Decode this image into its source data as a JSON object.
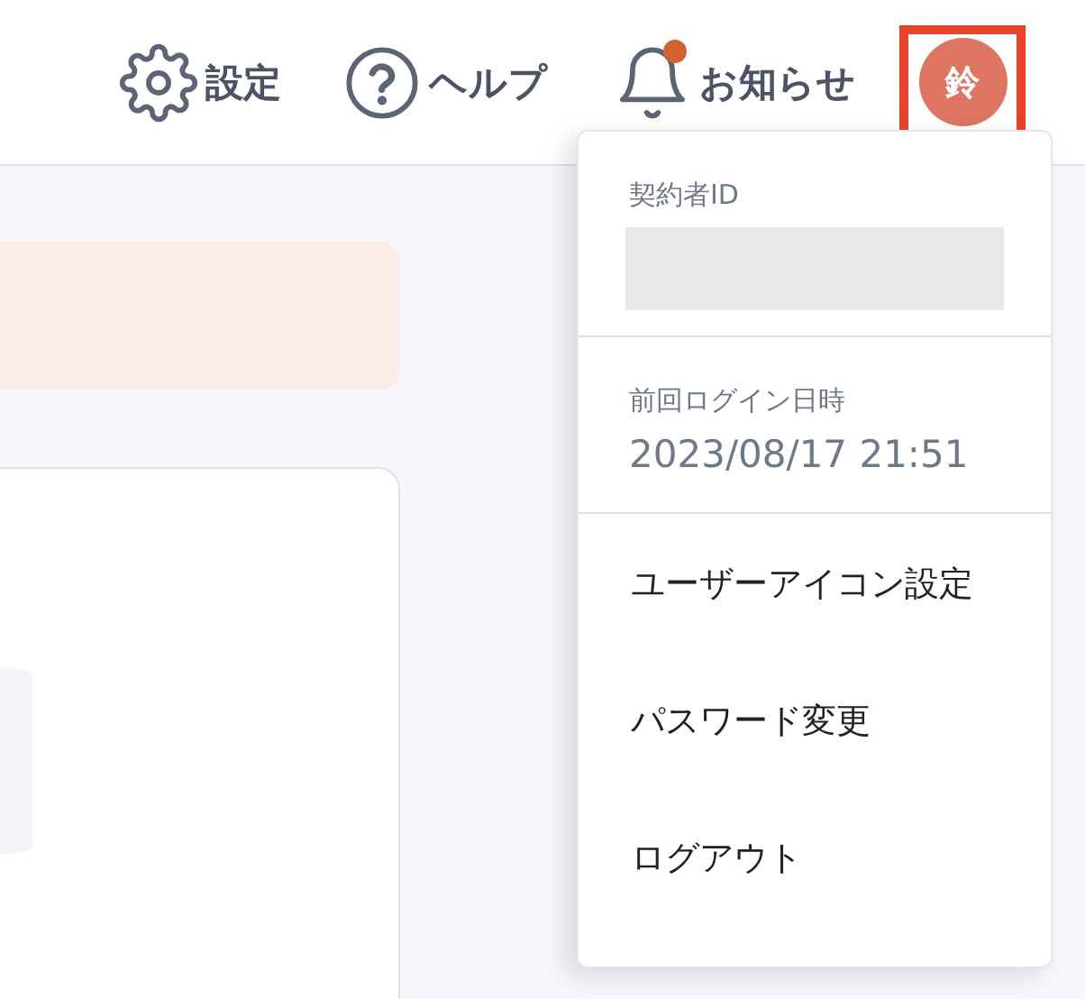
{
  "header": {
    "items": [
      {
        "kind": "settings",
        "label": "設定"
      },
      {
        "kind": "help",
        "label": "ヘルプ"
      },
      {
        "kind": "notifications",
        "label": "お知らせ",
        "unread": true
      }
    ],
    "avatar": {
      "initial": "鈴",
      "highlighted": true
    }
  },
  "user_menu": {
    "info": [
      {
        "kind": "masked",
        "label": "契約者ID"
      },
      {
        "kind": "text",
        "label": "前回ログイン日時",
        "value": "2023/08/17 21:51"
      }
    ],
    "items": [
      "ユーザーアイコン設定",
      "パスワード変更",
      "ログアウト"
    ]
  }
}
